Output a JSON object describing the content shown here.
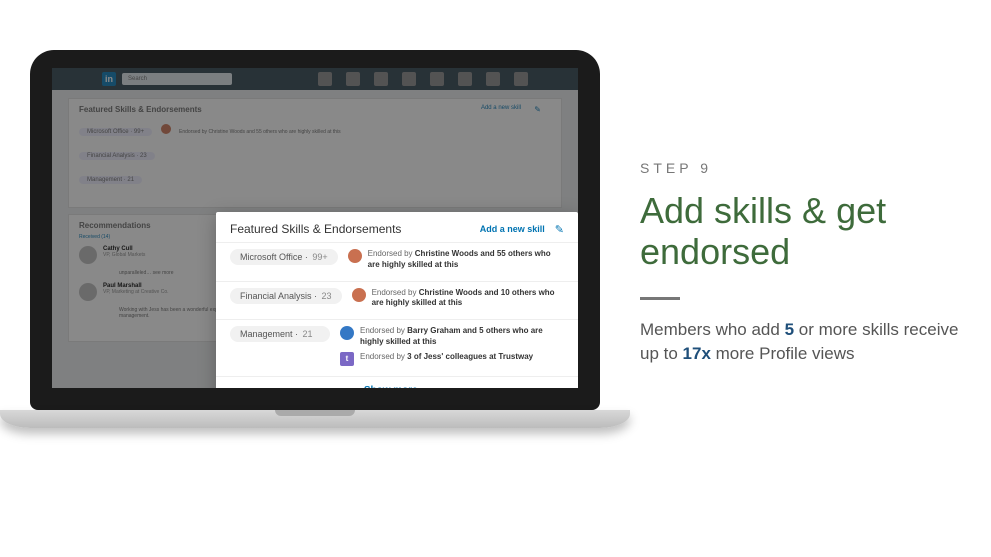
{
  "right": {
    "step": "STEP 9",
    "heading": "Add skills & get endorsed",
    "body_pre": "Members who add ",
    "body_b1": "5",
    "body_mid": " or more skills receive up to ",
    "body_b2": "17x",
    "body_post": " more Profile views"
  },
  "modal": {
    "title": "Featured Skills & Endorsements",
    "add": "Add a new skill",
    "show_more": "Show more",
    "skills": [
      {
        "name": "Microsoft Office",
        "count": "99+",
        "e1_pre": "Endorsed by ",
        "e1_b": "Christine Woods and 55 others who are highly skilled at this"
      },
      {
        "name": "Financial Analysis",
        "count": "23",
        "e1_pre": "Endorsed by ",
        "e1_b": "Christine Woods and 10 others who are highly skilled at this"
      },
      {
        "name": "Management",
        "count": "21",
        "e1_pre": "Endorsed by ",
        "e1_b": "Barry Graham and 5 others who are highly skilled at this",
        "e2_pre": "Endorsed by ",
        "e2_b": "3 of Jess' colleagues at Trustway"
      }
    ]
  },
  "bg": {
    "title": "Featured Skills & Endorsements",
    "add": "Add a new skill",
    "search": "Search",
    "pills": [
      "Microsoft Office · 99+",
      "Financial Analysis · 23",
      "Management · 21"
    ],
    "endorse": "Endorsed by Christine Woods and 55 others who are highly skilled at this",
    "rec_title": "Recommendations",
    "rec_received": "Received (14)",
    "rec1_name": "Cathy Cull",
    "rec1_sub": "VP, Global Markets",
    "rec2_name": "Paul Marshall",
    "rec2_sub": "VP, Marketing at Creative Co.",
    "rec_body": "Working with Jess has been a wonderful experience. She is a very talented young individual with a promising future. I would like to take note of her leadership skills as well as great time management.",
    "show": "Show more"
  },
  "icons": {
    "pencil": "✎",
    "chev": "⌄",
    "logo": "in"
  }
}
